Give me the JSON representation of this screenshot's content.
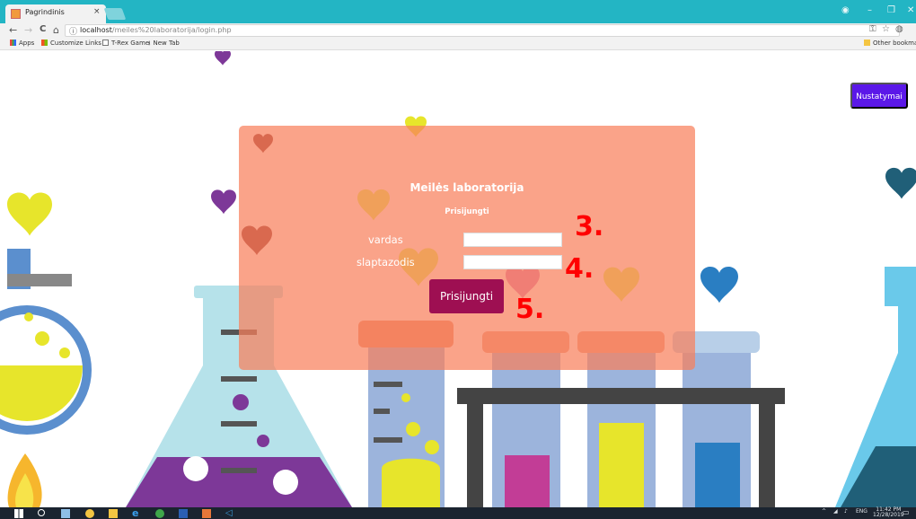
{
  "browser": {
    "tab_title": "Pagrindinis",
    "tab_close": "×",
    "window_controls": [
      "–",
      "❐",
      "✕"
    ],
    "url_host": "localhost",
    "url_path": "/meiles%20laboratorija/login.php",
    "nav": {
      "back": "←",
      "forward": "→",
      "reload": "C",
      "home": "⌂",
      "info": "ⓘ"
    },
    "toolbar_icons": {
      "key": "🔑",
      "star": "☆",
      "profile": "◍"
    },
    "bookmarks": [
      {
        "label": "Apps",
        "icon": "apps-icon"
      },
      {
        "label": "Customize Links",
        "icon": "windows-icon"
      },
      {
        "label": "T-Rex Game",
        "icon": "page-icon"
      },
      {
        "label": "New Tab",
        "icon": "download-icon"
      }
    ],
    "other_bookmarks": "Other bookmarks"
  },
  "page": {
    "settings_button": "Nustatymai",
    "title": "Meilės laboratorija",
    "subtitle": "Prisijungti",
    "username_label": "vardas",
    "password_label": "slaptazodis",
    "username_value": "",
    "password_value": "",
    "submit_label": "Prisijungti",
    "annotations": [
      "3.",
      "4.",
      "5."
    ]
  },
  "taskbar": {
    "time": "11:42 PM",
    "date": "12/28/2019",
    "language": "ENG",
    "tray_up": "^"
  },
  "colors": {
    "tab_strip": "#23b5c4",
    "login_panel": "#f8805c",
    "submit_button": "#9e0f52",
    "settings_button": "#5b18e8",
    "annotation": "#ff0000"
  }
}
